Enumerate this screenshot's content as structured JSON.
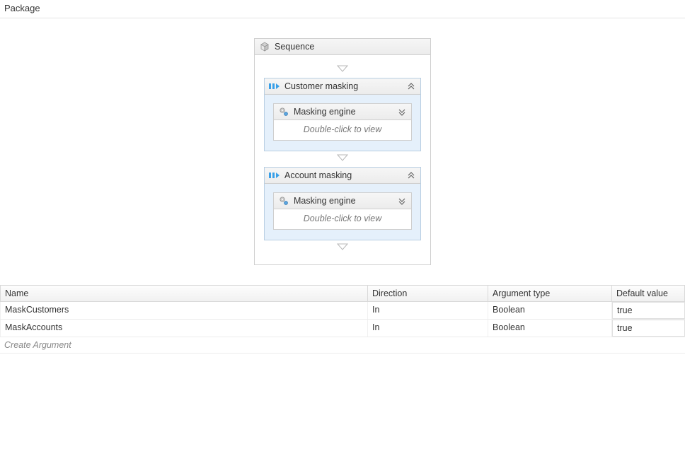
{
  "page": {
    "title": "Package"
  },
  "sequence": {
    "label": "Sequence",
    "hint": "Double-click to view",
    "activities": [
      {
        "title": "Customer masking",
        "inner_title": "Masking engine"
      },
      {
        "title": "Account masking",
        "inner_title": "Masking engine"
      }
    ]
  },
  "args": {
    "columns": {
      "name": "Name",
      "direction": "Direction",
      "type": "Argument type",
      "default": "Default value"
    },
    "rows": [
      {
        "name": "MaskCustomers",
        "direction": "In",
        "type": "Boolean",
        "default": "true"
      },
      {
        "name": "MaskAccounts",
        "direction": "In",
        "type": "Boolean",
        "default": "true"
      }
    ],
    "create_label": "Create Argument"
  }
}
